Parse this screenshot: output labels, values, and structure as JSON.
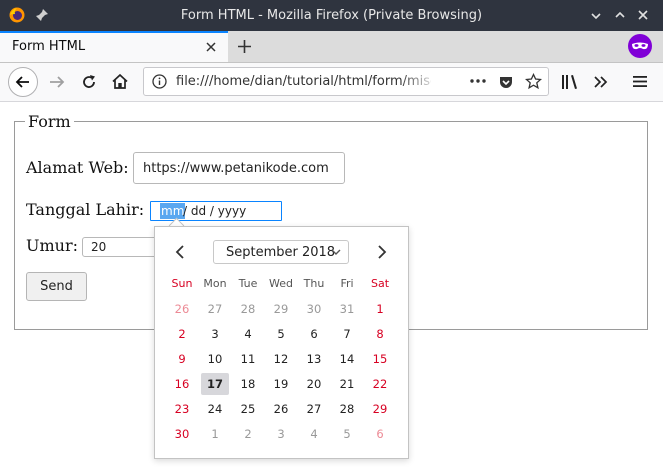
{
  "window": {
    "title": "Form HTML - Mozilla Firefox (Private Browsing)"
  },
  "tab": {
    "label": "Form HTML"
  },
  "navbar": {
    "url": "file:///home/dian/tutorial/html/form/misc"
  },
  "form": {
    "legend": "Form",
    "alamat_label": "Alamat Web:",
    "alamat_value": "https://www.petanikode.com",
    "tanggal_label": "Tanggal Lahir:",
    "tanggal_mm": "mm",
    "tanggal_rest": "/ dd / yyyy",
    "umur_label": "Umur:",
    "umur_value": "20",
    "send_label": "Send"
  },
  "datepicker": {
    "month_label": "September 2018",
    "weekdays": [
      "Sun",
      "Mon",
      "Tue",
      "Wed",
      "Thu",
      "Fri",
      "Sat"
    ],
    "weeks": [
      [
        "26",
        "27",
        "28",
        "29",
        "30",
        "31",
        "1"
      ],
      [
        "2",
        "3",
        "4",
        "5",
        "6",
        "7",
        "8"
      ],
      [
        "9",
        "10",
        "11",
        "12",
        "13",
        "14",
        "15"
      ],
      [
        "16",
        "17",
        "18",
        "19",
        "20",
        "21",
        "22"
      ],
      [
        "23",
        "24",
        "25",
        "26",
        "27",
        "28",
        "29"
      ],
      [
        "30",
        "1",
        "2",
        "3",
        "4",
        "5",
        "6"
      ]
    ],
    "today": "17"
  },
  "colors": {
    "accent": "#0a84ff",
    "weekend": "#d70022",
    "private_mask": "#8000d7",
    "titlebar": "#2f343f"
  }
}
